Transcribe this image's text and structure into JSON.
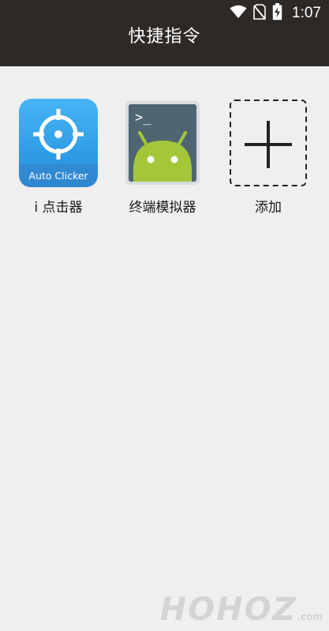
{
  "status_bar": {
    "time": "1:07",
    "icons": [
      "wifi-icon",
      "no-sim-icon",
      "battery-charging-icon"
    ]
  },
  "header": {
    "title": "快捷指令"
  },
  "shortcuts": [
    {
      "label": "i 点击器",
      "icon": "auto-clicker-icon",
      "icon_text": "Auto Clicker"
    },
    {
      "label": "终端模拟器",
      "icon": "terminal-emulator-icon",
      "icon_text": ">_"
    },
    {
      "label": "添加",
      "icon": "add-icon"
    }
  ],
  "watermark": {
    "text": "ᕼOᕼOZ",
    "suffix": ".com"
  },
  "colors": {
    "header_bg": "#2c2927",
    "background": "#efefef",
    "auto_clicker_blue": "#2f9fe6",
    "android_green": "#a4c639",
    "terminal_bg": "#5a6e7a"
  }
}
